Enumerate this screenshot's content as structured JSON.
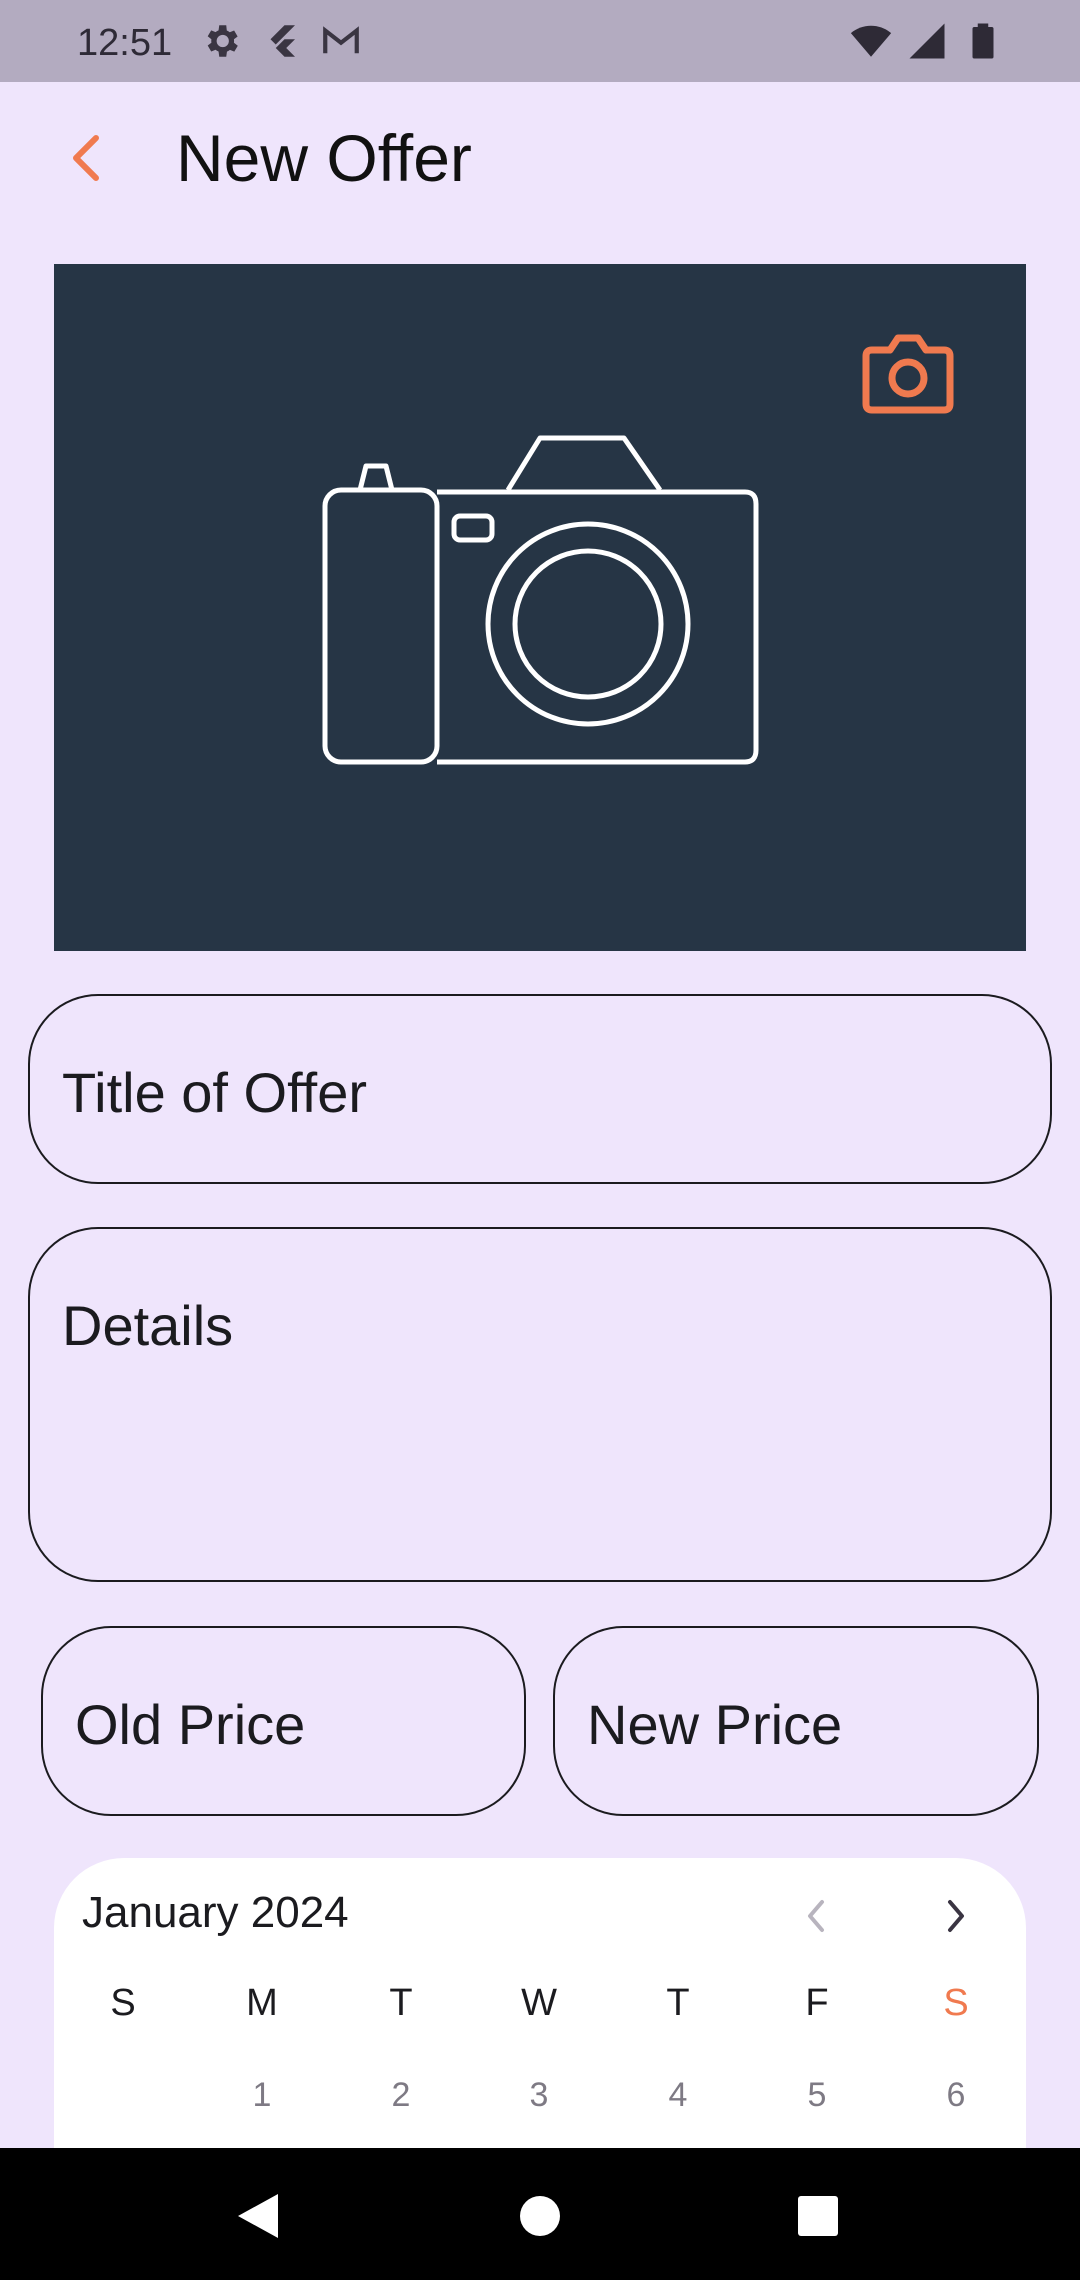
{
  "status_bar": {
    "time": "12:51",
    "left_icons": [
      "gear-icon",
      "flutter-icon",
      "gmail-icon"
    ],
    "right_icons": [
      "wifi-icon",
      "cellular-icon",
      "battery-icon"
    ],
    "background": "#B3ABC0"
  },
  "app_bar": {
    "title": "New Offer",
    "back_icon": "chevron-left-icon"
  },
  "image_panel": {
    "placeholder_icon": "camera-outline-icon",
    "action_icon": "camera-icon",
    "background": "#263545"
  },
  "form": {
    "title_placeholder": "Title of Offer",
    "details_placeholder": "Details",
    "old_price_placeholder": "Old Price",
    "new_price_placeholder": "New Price"
  },
  "calendar": {
    "month_label": "January 2024",
    "weekdays": [
      "S",
      "M",
      "T",
      "W",
      "T",
      "F",
      "S"
    ],
    "first_row_days": [
      "",
      "1",
      "2",
      "3",
      "4",
      "5",
      "6"
    ],
    "prev_icon": "chevron-left-icon",
    "next_icon": "chevron-right-icon"
  },
  "colors": {
    "accent": "#F07A4F",
    "background": "#EFE5FC",
    "panel": "#263545"
  },
  "nav_bar": {
    "buttons": [
      "back-triangle-icon",
      "home-circle-icon",
      "recents-square-icon"
    ]
  }
}
